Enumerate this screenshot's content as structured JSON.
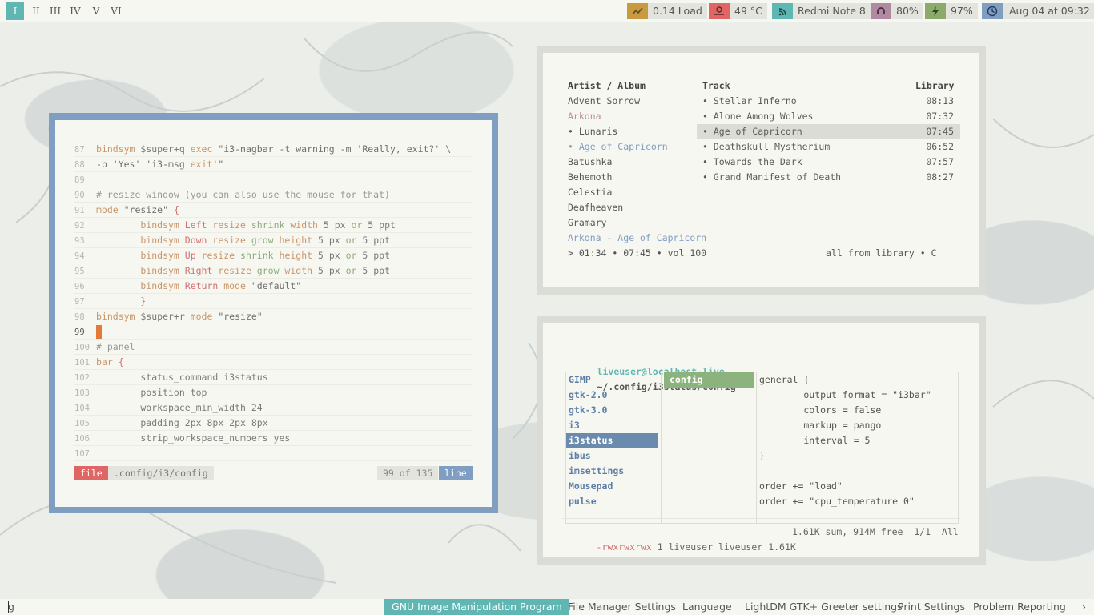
{
  "topbar": {
    "workspaces": [
      "I",
      "II",
      "III",
      "IV",
      "V",
      "VI"
    ],
    "status": [
      {
        "icon": "load-chart-icon",
        "text": "0.14 Load",
        "color": "#c99a3f"
      },
      {
        "icon": "thermometer-icon",
        "text": "49 °C",
        "color": "#e06666"
      },
      {
        "icon": "wifi-icon",
        "text": "Redmi Note 8",
        "color": "#5fb6b3"
      },
      {
        "icon": "headphones-icon",
        "text": "80%",
        "color": "#b08aa0"
      },
      {
        "icon": "battery-bolt-icon",
        "text": "97%",
        "color": "#8caa6a"
      },
      {
        "icon": "clock-icon",
        "text": "Aug 04 at 09:32",
        "color": "#7f9ec2"
      }
    ]
  },
  "editor": {
    "lines": [
      {
        "n": "87",
        "parts": [
          [
            "t-k",
            "bindsym "
          ],
          [
            "t-n",
            "$super+q "
          ],
          [
            "t-k",
            "exec "
          ],
          [
            "t-s",
            "\"i3-nagbar -t warning -m 'Really, exit?' \\"
          ]
        ]
      },
      {
        "n": "88",
        "parts": [
          [
            "t-s",
            "-b 'Yes' 'i3-msg "
          ],
          [
            "t-k",
            "exit"
          ],
          [
            "t-s",
            "'\""
          ]
        ]
      },
      {
        "n": "89",
        "parts": []
      },
      {
        "n": "90",
        "parts": [
          [
            "t-c",
            "# resize window (you can also use the mouse for that)"
          ]
        ]
      },
      {
        "n": "91",
        "parts": [
          [
            "t-k",
            "mode "
          ],
          [
            "t-s",
            "\"resize\" "
          ],
          [
            "t-r",
            "{"
          ]
        ]
      },
      {
        "n": "92",
        "parts": [
          [
            "t-k",
            "        bindsym "
          ],
          [
            "t-r",
            "Left "
          ],
          [
            "t-k",
            "resize "
          ],
          [
            "t-g",
            "shrink "
          ],
          [
            "t-k",
            "width "
          ],
          [
            "t-n",
            "5 px "
          ],
          [
            "t-g",
            "or "
          ],
          [
            "t-n",
            "5 ppt"
          ]
        ]
      },
      {
        "n": "93",
        "parts": [
          [
            "t-k",
            "        bindsym "
          ],
          [
            "t-r",
            "Down "
          ],
          [
            "t-k",
            "resize "
          ],
          [
            "t-g",
            "grow "
          ],
          [
            "t-k",
            "height "
          ],
          [
            "t-n",
            "5 px "
          ],
          [
            "t-g",
            "or "
          ],
          [
            "t-n",
            "5 ppt"
          ]
        ]
      },
      {
        "n": "94",
        "parts": [
          [
            "t-k",
            "        bindsym "
          ],
          [
            "t-r",
            "Up "
          ],
          [
            "t-k",
            "resize "
          ],
          [
            "t-g",
            "shrink "
          ],
          [
            "t-k",
            "height "
          ],
          [
            "t-n",
            "5 px "
          ],
          [
            "t-g",
            "or "
          ],
          [
            "t-n",
            "5 ppt"
          ]
        ]
      },
      {
        "n": "95",
        "parts": [
          [
            "t-k",
            "        bindsym "
          ],
          [
            "t-r",
            "Right "
          ],
          [
            "t-k",
            "resize "
          ],
          [
            "t-g",
            "grow "
          ],
          [
            "t-k",
            "width "
          ],
          [
            "t-n",
            "5 px "
          ],
          [
            "t-g",
            "or "
          ],
          [
            "t-n",
            "5 ppt"
          ]
        ]
      },
      {
        "n": "96",
        "parts": [
          [
            "t-k",
            "        bindsym "
          ],
          [
            "t-r",
            "Return "
          ],
          [
            "t-k",
            "mode "
          ],
          [
            "t-s",
            "\"default\""
          ]
        ]
      },
      {
        "n": "97",
        "parts": [
          [
            "t-r",
            "        }"
          ]
        ]
      },
      {
        "n": "98",
        "parts": [
          [
            "t-k",
            "bindsym "
          ],
          [
            "t-n",
            "$super+r "
          ],
          [
            "t-k",
            "mode "
          ],
          [
            "t-s",
            "\"resize\""
          ]
        ]
      },
      {
        "n": "99",
        "parts": [],
        "cursor": true
      },
      {
        "n": "100",
        "parts": [
          [
            "t-c",
            "# panel"
          ]
        ]
      },
      {
        "n": "101",
        "parts": [
          [
            "t-k",
            "bar "
          ],
          [
            "t-r",
            "{"
          ]
        ]
      },
      {
        "n": "102",
        "parts": [
          [
            "t-n",
            "        status_command i3status"
          ]
        ]
      },
      {
        "n": "103",
        "parts": [
          [
            "t-n",
            "        position top"
          ]
        ]
      },
      {
        "n": "104",
        "parts": [
          [
            "t-n",
            "        workspace_min_width 24"
          ]
        ]
      },
      {
        "n": "105",
        "parts": [
          [
            "t-n",
            "        padding 2px 8px 2px 8px"
          ]
        ]
      },
      {
        "n": "106",
        "parts": [
          [
            "t-n",
            "        strip_workspace_numbers yes"
          ]
        ]
      },
      {
        "n": "107",
        "parts": []
      }
    ],
    "status": {
      "mode": "file",
      "path": ".config/i3/config",
      "pos": "99 of 135",
      "unit": "line"
    }
  },
  "music": {
    "headers": {
      "artist": "Artist / Album",
      "track": "Track",
      "library": "Library"
    },
    "artists": [
      "Advent Sorrow",
      "Arkona",
      "• Lunaris",
      "• Age of Capricorn",
      "Batushka",
      "Behemoth",
      "Celestia",
      "Deafheaven",
      "Gramary"
    ],
    "tracks": [
      {
        "title": "• Stellar Inferno",
        "time": "08:13"
      },
      {
        "title": "• Alone Among Wolves",
        "time": "07:32"
      },
      {
        "title": "• Age of Capricorn",
        "time": "07:45"
      },
      {
        "title": "• Deathskull Mystherium",
        "time": "06:52"
      },
      {
        "title": "• Towards the Dark",
        "time": "07:57"
      },
      {
        "title": "• Grand Manifest of Death",
        "time": "08:27"
      }
    ],
    "nowplaying": "Arkona - Age of Capricorn",
    "progress": "> 01:34 • 07:45 • vol 100",
    "mode": "all from library • C"
  },
  "filemanager": {
    "user": "liveuser@localhost-live",
    "path": "~/.config/i3status/config",
    "dirs": [
      "GIMP",
      "gtk-2.0",
      "gtk-3.0",
      "i3",
      "i3status",
      "ibus",
      "imsettings",
      "Mousepad",
      "pulse"
    ],
    "selected_file": "config",
    "preview": [
      "general {",
      "        output_format = \"i3bar\"",
      "        colors = false",
      "        markup = pango",
      "        interval = 5",
      "}",
      "",
      "order += \"load\"",
      "order += \"cpu_temperature 0\""
    ],
    "footer_left": "-rwxrwxrwx 1 liveuser liveuser 1.61K",
    "footer_right": "1.61K sum, 914M free  1/1  All"
  },
  "bottombar": {
    "input": "g",
    "items": [
      "GNU Image Manipulation Program",
      "File Manager Settings",
      "Language",
      "LightDM GTK+ Greeter settings",
      "Print Settings",
      "Problem Reporting"
    ],
    "more": "›"
  }
}
